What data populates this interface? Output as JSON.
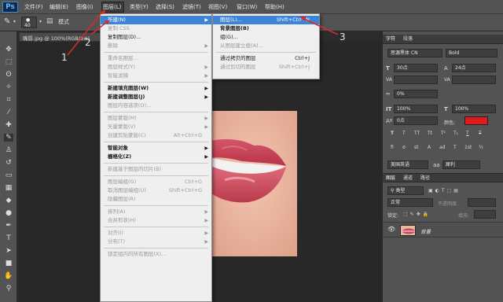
{
  "app": {
    "logo": "Ps",
    "menu": [
      "文件(F)",
      "编辑(E)",
      "图像(I)",
      "图层(L)",
      "类型(Y)",
      "选择(S)",
      "滤镜(T)",
      "视图(V)",
      "窗口(W)",
      "帮助(H)"
    ]
  },
  "options_bar": {
    "brush_size": "40",
    "mode_label": "模式"
  },
  "document": {
    "tab_title": "嘴唇.jpg @ 100%(RGB/8#)"
  },
  "layer_menu": {
    "items": [
      {
        "label": "新建(N)",
        "submenu": true,
        "highlight": true
      },
      {
        "label": "复制 CSS",
        "disabled": true
      },
      {
        "label": "复制图层(D)..."
      },
      {
        "label": "删除",
        "submenu": true,
        "disabled": true
      },
      {
        "sep": true
      },
      {
        "label": "重命名图层...",
        "disabled": true
      },
      {
        "label": "图层样式(Y)",
        "submenu": true,
        "disabled": true
      },
      {
        "label": "智能滤镜",
        "submenu": true,
        "disabled": true
      },
      {
        "sep": true
      },
      {
        "label": "新建填充图层(W)",
        "submenu": true,
        "bold": true
      },
      {
        "label": "新建调整图层(J)",
        "submenu": true,
        "bold": true
      },
      {
        "label": "图层内容选项(O)...",
        "disabled": true
      },
      {
        "sep": true
      },
      {
        "label": "图层蒙版(M)",
        "submenu": true,
        "disabled": true
      },
      {
        "label": "矢量蒙版(V)",
        "submenu": true,
        "disabled": true
      },
      {
        "label": "创建剪贴蒙版(C)",
        "shortcut": "Alt+Ctrl+G",
        "disabled": true
      },
      {
        "sep": true
      },
      {
        "label": "智能对象",
        "submenu": true,
        "bold": true
      },
      {
        "label": "栅格化(Z)",
        "submenu": true,
        "bold": true
      },
      {
        "sep": true
      },
      {
        "label": "新建基于图层的切片(B)",
        "disabled": true
      },
      {
        "sep": true
      },
      {
        "label": "图层编组(G)",
        "shortcut": "Ctrl+G",
        "disabled": true
      },
      {
        "label": "取消图层编组(U)",
        "shortcut": "Shift+Ctrl+G",
        "disabled": true
      },
      {
        "label": "隐藏图层(R)",
        "disabled": true
      },
      {
        "sep": true
      },
      {
        "label": "排列(A)",
        "submenu": true,
        "disabled": true
      },
      {
        "label": "合并形状(H)",
        "submenu": true,
        "disabled": true
      },
      {
        "sep": true
      },
      {
        "label": "对齐(I)",
        "submenu": true,
        "disabled": true
      },
      {
        "label": "分布(T)",
        "submenu": true,
        "disabled": true
      },
      {
        "sep": true
      },
      {
        "label": "锁定组内的所有图层(X)...",
        "disabled": true
      }
    ]
  },
  "new_submenu": {
    "items": [
      {
        "label": "图层(L)...",
        "shortcut": "Shift+Ctrl+N",
        "highlight": true
      },
      {
        "label": "背景图层(B)",
        "bold": true
      },
      {
        "label": "组(G)..."
      },
      {
        "label": "从图层建立组(A)...",
        "disabled": true
      },
      {
        "sep": true
      },
      {
        "label": "通过拷贝的图层",
        "shortcut": "Ctrl+J"
      },
      {
        "label": "通过剪切的图层",
        "shortcut": "Shift+Ctrl+J",
        "disabled": true
      }
    ]
  },
  "annotations": [
    "1",
    "2",
    "3"
  ],
  "character_panel": {
    "tabs": [
      "字符",
      "段落"
    ],
    "font_family": "思源黑体 CN",
    "font_style": "Bold",
    "size": "30点",
    "leading": "24点",
    "tracking": "0%",
    "vscale": "100%",
    "hscale": "100%",
    "baseline": "0点",
    "color_label": "颜色:",
    "color": "#e01a1a",
    "language": "美国英语",
    "antialias": "犀利",
    "style_buttons": [
      "T",
      "T",
      "TT",
      "Tt",
      "T¹",
      "T₁",
      "T",
      "T"
    ],
    "style_buttons2": [
      "fi",
      "σ",
      "st",
      "A",
      "ad",
      "T",
      "1st",
      "½"
    ]
  },
  "layers_panel": {
    "tabs": [
      "图层",
      "通道",
      "路径"
    ],
    "kind_label": "类型",
    "blend_mode": "正常",
    "opacity_label": "不透明度:",
    "lock_label": "锁定:",
    "fill_label": "填充:",
    "layer_name": "背景"
  }
}
